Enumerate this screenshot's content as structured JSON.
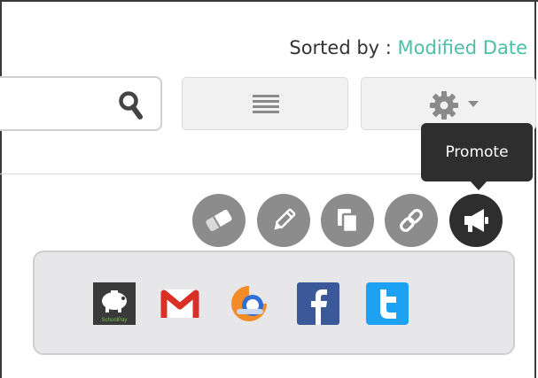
{
  "header": {
    "sorted_label": "Sorted by : ",
    "sorted_value": "Modified Date"
  },
  "toolbar": {
    "search_placeholder": "",
    "list_view_icon": "list-icon",
    "settings_icon": "gear-icon"
  },
  "tooltip": {
    "text": "Promote"
  },
  "actions": [
    {
      "icon": "eraser-icon"
    },
    {
      "icon": "pencil-icon"
    },
    {
      "icon": "copy-icon"
    },
    {
      "icon": "link-icon"
    },
    {
      "icon": "megaphone-icon"
    }
  ],
  "share_panel": {
    "items": [
      {
        "icon": "schoolpay-icon",
        "label": "SchoolPay"
      },
      {
        "icon": "gmail-icon"
      },
      {
        "icon": "app-icon"
      },
      {
        "icon": "facebook-icon"
      },
      {
        "icon": "twitter-icon"
      }
    ]
  },
  "colors": {
    "accent": "#4cbfa6",
    "tooltip_bg": "#2e2e2e",
    "action_gray": "#8c8c8c",
    "facebook": "#3b5998",
    "twitter": "#1da1f2",
    "gmail": "#d93025"
  }
}
